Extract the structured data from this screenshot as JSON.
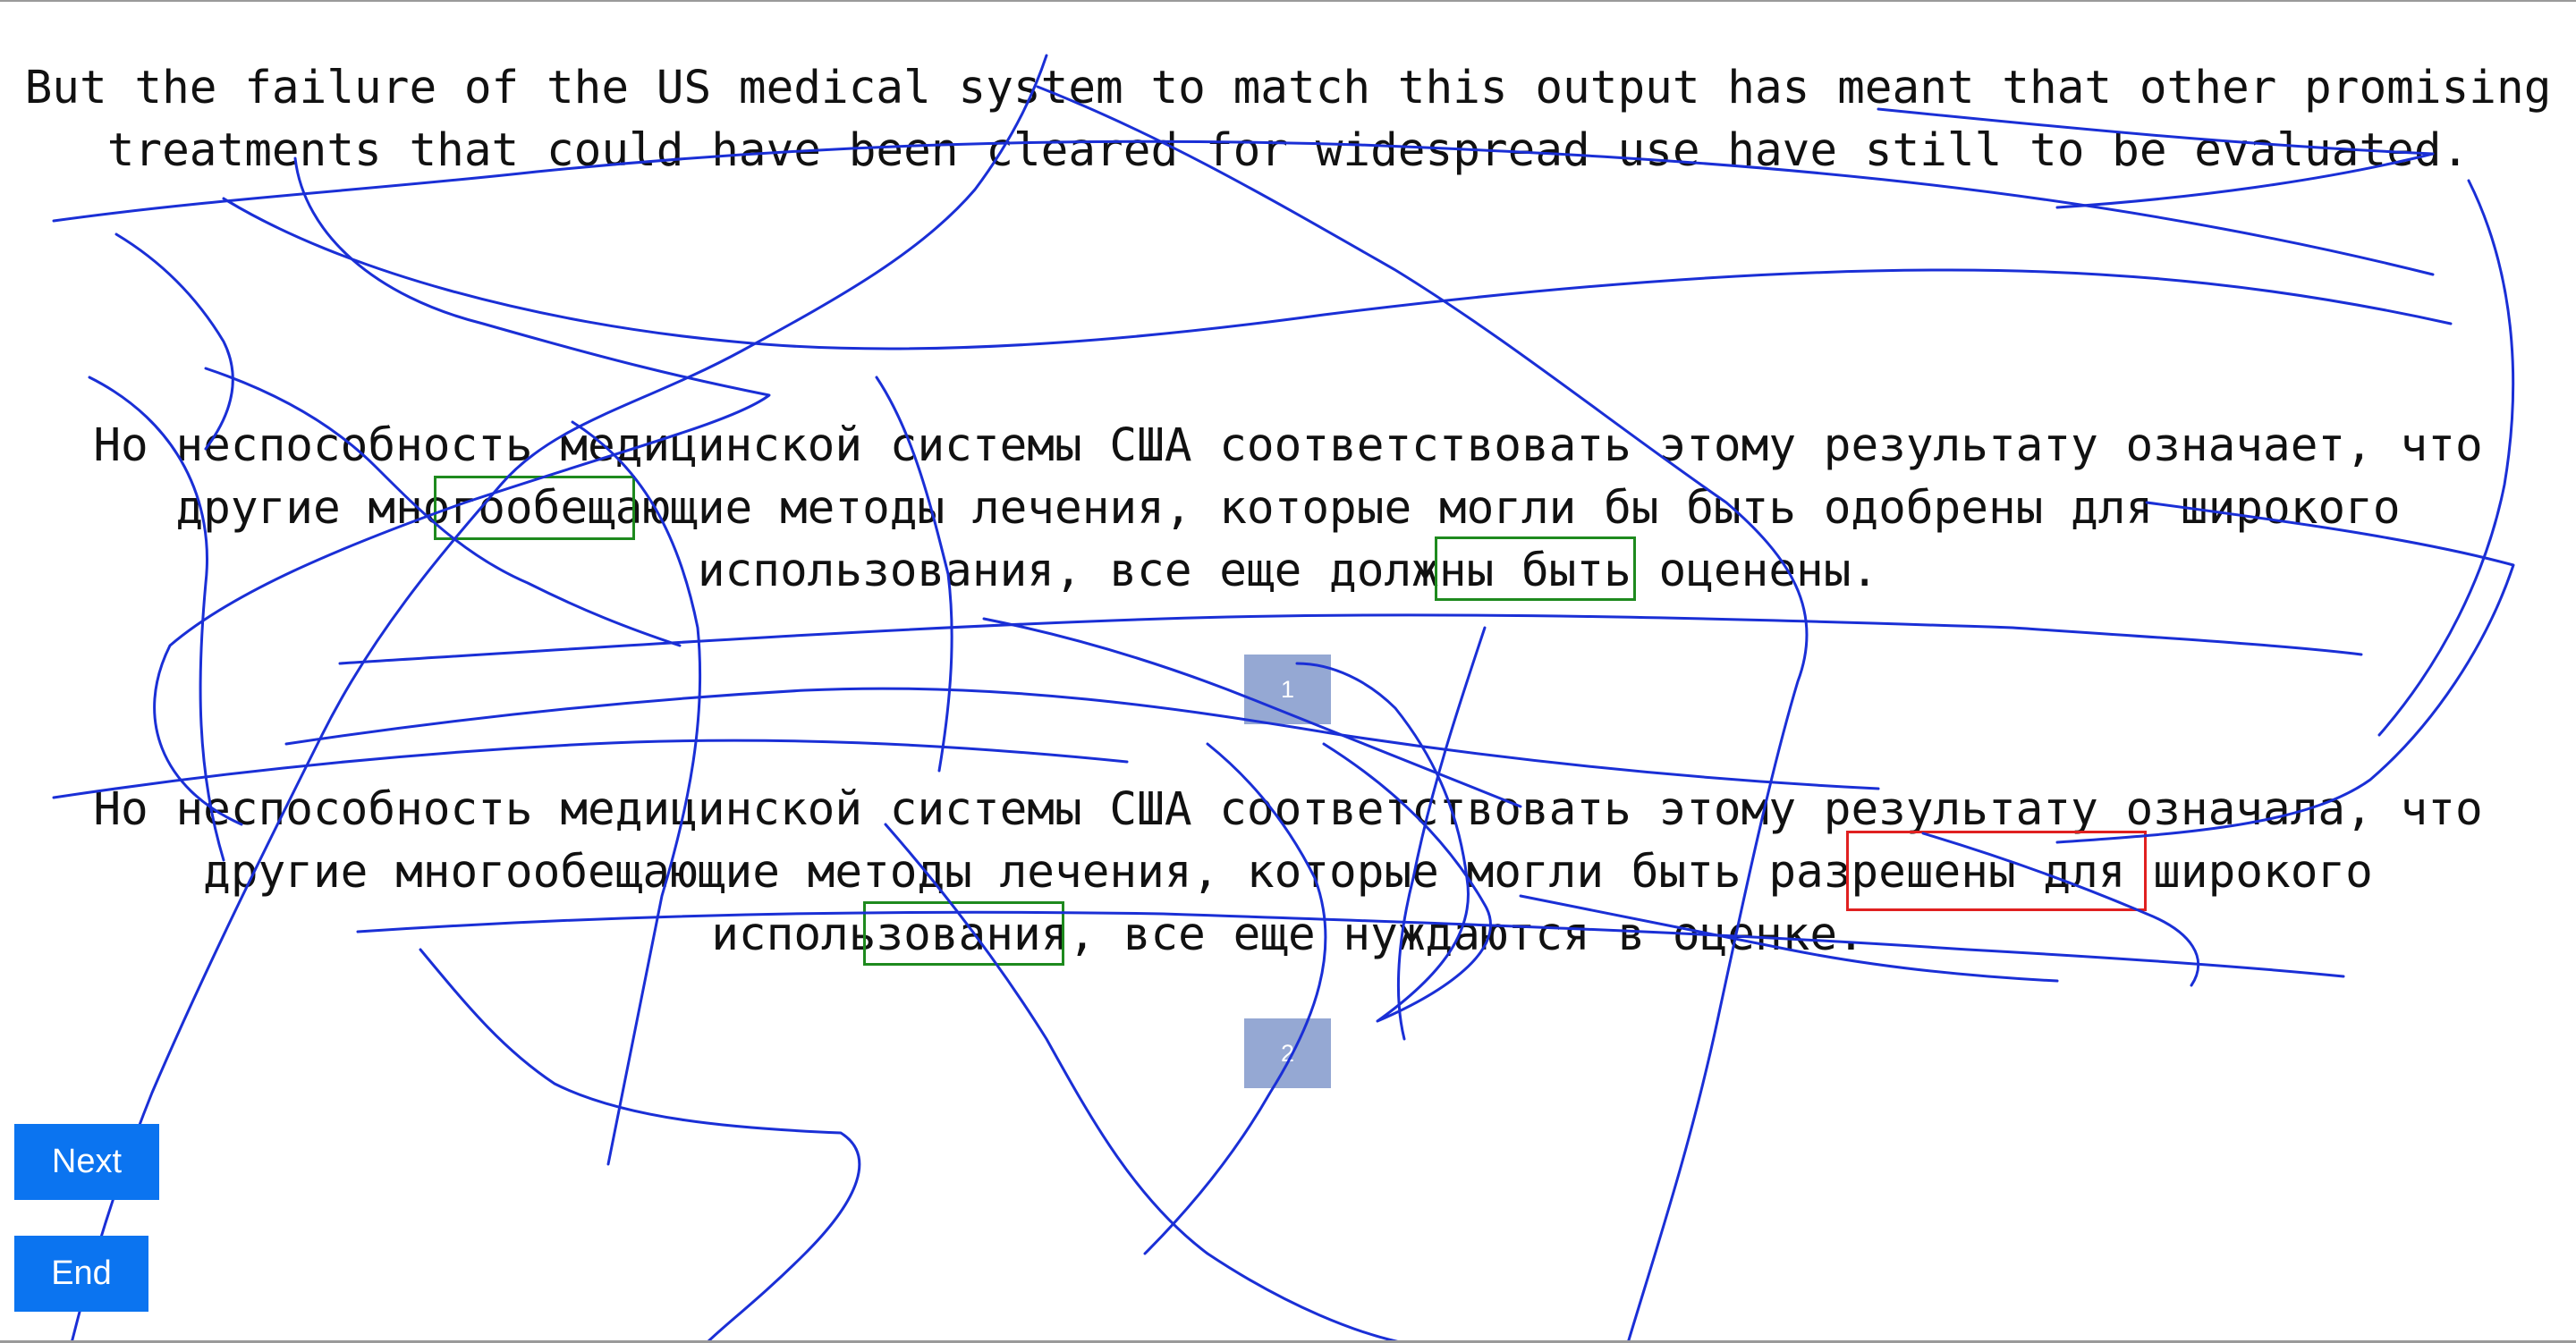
{
  "passages": {
    "source": "But the failure of the US medical system to match this output has meant that other promising treatments that could have been cleared for widespread use have still to be evaluated.",
    "translation_1": "Но неспособность медицинской системы США соответствовать этому результату означает, что другие многообещающие методы лечения, которые могли бы быть одобрены для широкого использования, все еще должны быть оценены.",
    "translation_2": "Но неспособность медицинской системы США соответствовать этому результату означала, что другие многообещающие методы лечения, которые могли быть разрешены для широкого использования, все еще нуждаются в оценке."
  },
  "badges": {
    "first": "1",
    "second": "2"
  },
  "buttons": {
    "next": "Next",
    "end": "End"
  },
  "colors": {
    "badge": "#95a8d3",
    "button": "#0b74f0",
    "mark_good": "#1e8a1e",
    "mark_bad": "#e02020",
    "scribble": "#1a2fd6"
  }
}
